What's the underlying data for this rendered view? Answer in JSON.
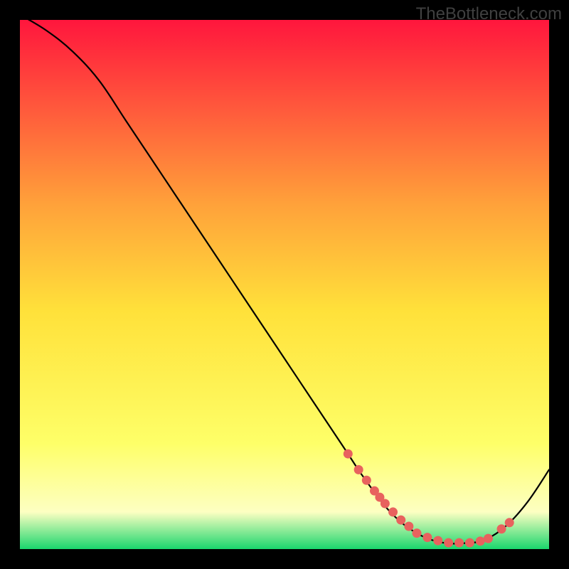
{
  "watermark": "TheBottleneck.com",
  "colors": {
    "bg": "#000000",
    "gradient_top": "#ff163d",
    "gradient_upper_mid": "#ffa23a",
    "gradient_mid": "#ffe13a",
    "gradient_lower": "#feff68",
    "gradient_cream": "#fdffc2",
    "gradient_bottom": "#1ad66d",
    "curve": "#000000",
    "marker": "#e8625e"
  },
  "chart_data": {
    "type": "line",
    "title": "",
    "xlabel": "",
    "ylabel": "",
    "xlim": [
      0,
      100
    ],
    "ylim": [
      0,
      100
    ],
    "series": [
      {
        "name": "bottleneck-curve",
        "x": [
          0,
          5,
          10,
          15,
          20,
          25,
          30,
          35,
          40,
          45,
          50,
          55,
          60,
          62,
          65,
          70,
          75,
          80,
          85,
          88,
          92,
          96,
          100
        ],
        "y": [
          101,
          98,
          94,
          88.5,
          81,
          73.5,
          66,
          58.5,
          51,
          43.5,
          36,
          28.5,
          21,
          18,
          13.5,
          7,
          3,
          1.2,
          1.2,
          1.8,
          4.5,
          9,
          15
        ]
      }
    ],
    "markers": {
      "name": "highlighted-points",
      "x": [
        62,
        64,
        65.5,
        67,
        68,
        69,
        70.5,
        72,
        73.5,
        75,
        77,
        79,
        81,
        83,
        85,
        87,
        88.5,
        91,
        92.5
      ],
      "y": [
        18,
        15,
        13,
        11,
        9.8,
        8.6,
        7,
        5.5,
        4.3,
        3,
        2.2,
        1.6,
        1.2,
        1.2,
        1.2,
        1.5,
        2.0,
        3.8,
        5.0
      ]
    },
    "annotations": []
  }
}
